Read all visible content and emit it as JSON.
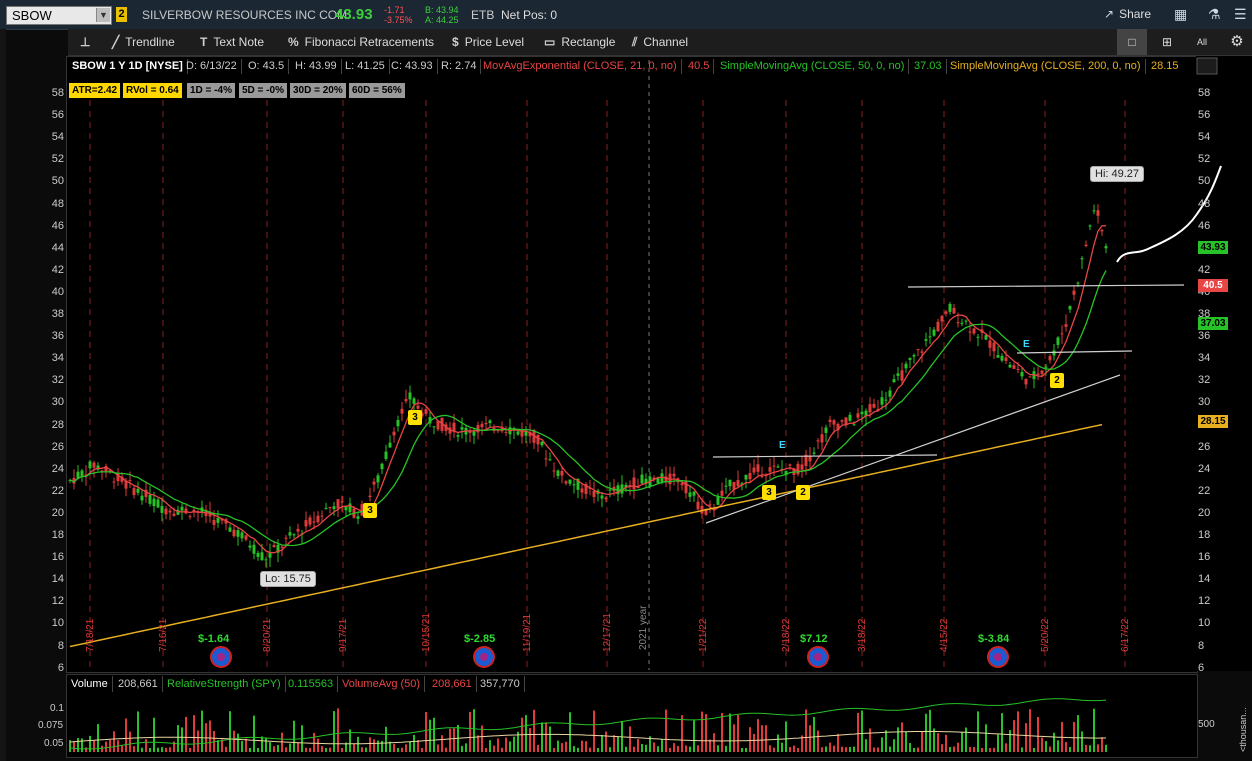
{
  "header": {
    "symbol": "SBOW",
    "link_group": "2",
    "company": "SILVERBOW RESOURCES INC COM",
    "last": "43.93",
    "change_abs": "-1.71",
    "change_pct": "-3.75%",
    "bid": "B: 43.94",
    "ask": "A: 44.25",
    "exchange": "ETB",
    "net_pos": "Net Pos: 0",
    "share": "Share"
  },
  "toolbar": {
    "tools": [
      "Trendline",
      "Text Note",
      "Fibonacci Retracements",
      "Price Level",
      "Rectangle",
      "Channel"
    ],
    "all_label": "All"
  },
  "chart_header": {
    "title": "SBOW 1 Y 1D [NYSE]",
    "date": "D: 6/13/22",
    "open": "O: 43.5",
    "high": "H: 43.99",
    "low": "L: 41.25",
    "close": "C: 43.93",
    "range": "R: 2.74",
    "ema": "MovAvgExponential (CLOSE, 21, 0, no)",
    "ema_val": "40.5",
    "sma50": "SimpleMovingAvg (CLOSE, 50, 0, no)",
    "sma50_val": "37.03",
    "sma200": "SimpleMovingAvg (CLOSE, 200, 0, no)",
    "sma200_val": "28.15"
  },
  "stats": {
    "atr": "ATR=2.42",
    "rvol": "RVol = 0.64",
    "d1": "1D = -4%",
    "d5": "5D = -0%",
    "d30": "30D = 20%",
    "d60": "60D = 56%"
  },
  "price_axis": [
    "58",
    "56",
    "54",
    "52",
    "50",
    "48",
    "46",
    "44",
    "42",
    "40",
    "38",
    "36",
    "34",
    "32",
    "30",
    "28",
    "26",
    "24",
    "22",
    "20",
    "18",
    "16",
    "14",
    "12",
    "10",
    "8",
    "6"
  ],
  "price_tags": {
    "last": "43.93",
    "ema": "40.5",
    "sma50": "37.03",
    "sma200": "28.15"
  },
  "date_labels": [
    "7/18/21",
    "7/16/21",
    "8/20/21",
    "9/17/21",
    "10/15/21",
    "11/19/21",
    "12/17/21",
    "1/21/22",
    "2/18/22",
    "3/18/22",
    "4/15/22",
    "5/20/22",
    "6/17/22"
  ],
  "year_label": "2021 year",
  "callouts": {
    "hi": "Hi: 49.27",
    "lo": "Lo: 15.75"
  },
  "markers": [
    "3",
    "3",
    "3",
    "2",
    "2"
  ],
  "earnings_marker": "E",
  "dividends": [
    "$-1.64",
    "$-2.85",
    "$7.12",
    "$-3.84"
  ],
  "volume": {
    "label": "Volume",
    "value": "208,661",
    "rs_label": "RelativeStrength (SPY)",
    "rs_val": "0.115563",
    "va_label": "VolumeAvg (50)",
    "va_val": "208,661",
    "va_val2": "357,770",
    "left_ticks": [
      "0.1",
      "0.075",
      "0.05"
    ],
    "right_tick": "500",
    "unit": "<thousan..."
  },
  "colors": {
    "ema": "#e84545",
    "sma50": "#27c227",
    "sma200": "#e8b020",
    "up": "#27c227",
    "down": "#e03a3a"
  }
}
